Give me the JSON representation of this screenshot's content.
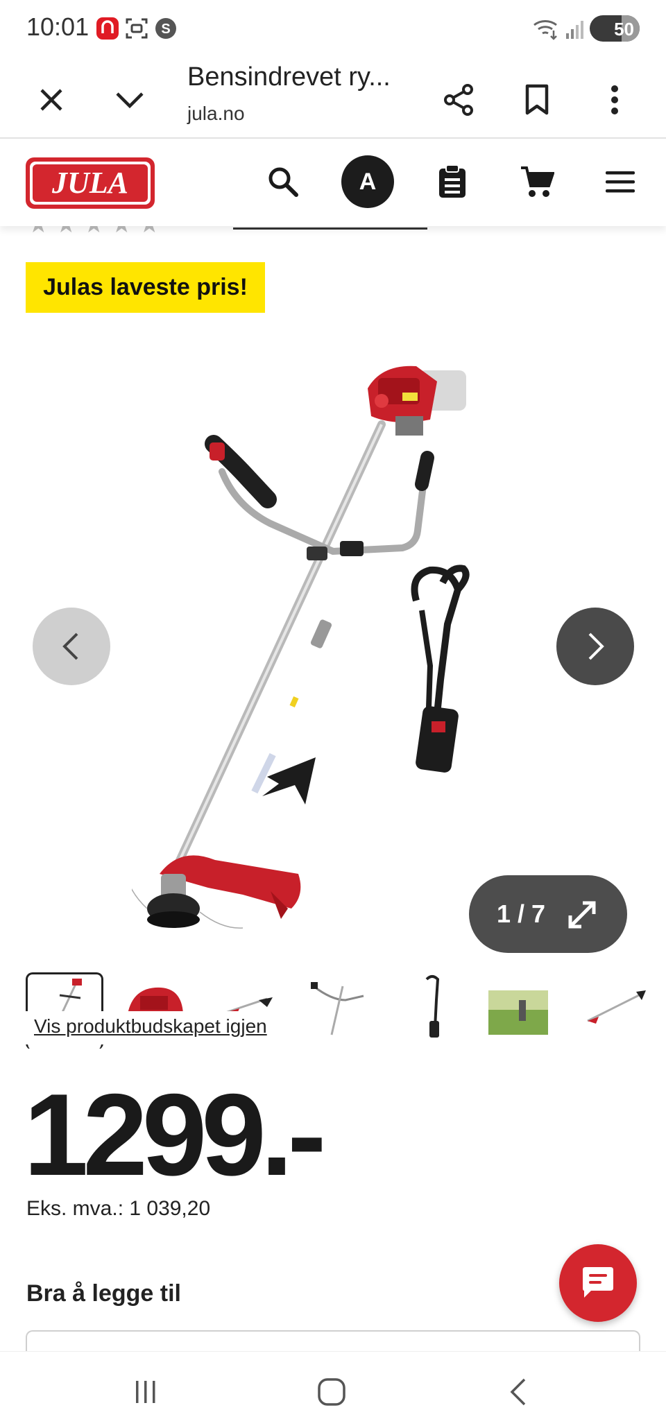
{
  "status_bar": {
    "time": "10:01",
    "battery_level": "50",
    "icons": [
      "notification-app-icon",
      "screenshot-icon",
      "s-app-icon",
      "wifi-icon",
      "signal-icon",
      "battery-icon"
    ]
  },
  "browser": {
    "page_title": "Bensindrevet ry...",
    "url": "jula.no",
    "buttons": [
      "close-icon",
      "chevron-down-icon",
      "share-icon",
      "bookmark-icon",
      "more-vert-icon"
    ]
  },
  "site_header": {
    "logo_text": "JULA",
    "avatar_letter": "A",
    "brand_color": "#d3262e"
  },
  "badge": {
    "text": "Julas laveste pris!",
    "color": "#ffe500"
  },
  "gallery": {
    "counter": "1 / 7",
    "current_index": 1,
    "total_images": 7
  },
  "thumbnails": {
    "relink_text": "Vis produktbudskapet igjen",
    "items": [
      "thumb-1",
      "thumb-2",
      "thumb-3",
      "thumb-4",
      "thumb-5",
      "thumb-6",
      "thumb-7"
    ]
  },
  "price": {
    "main": "1299.-",
    "vat_line": "Eks. mva.: 1 039,20"
  },
  "addons": {
    "section_title": "Bra å legge til"
  }
}
